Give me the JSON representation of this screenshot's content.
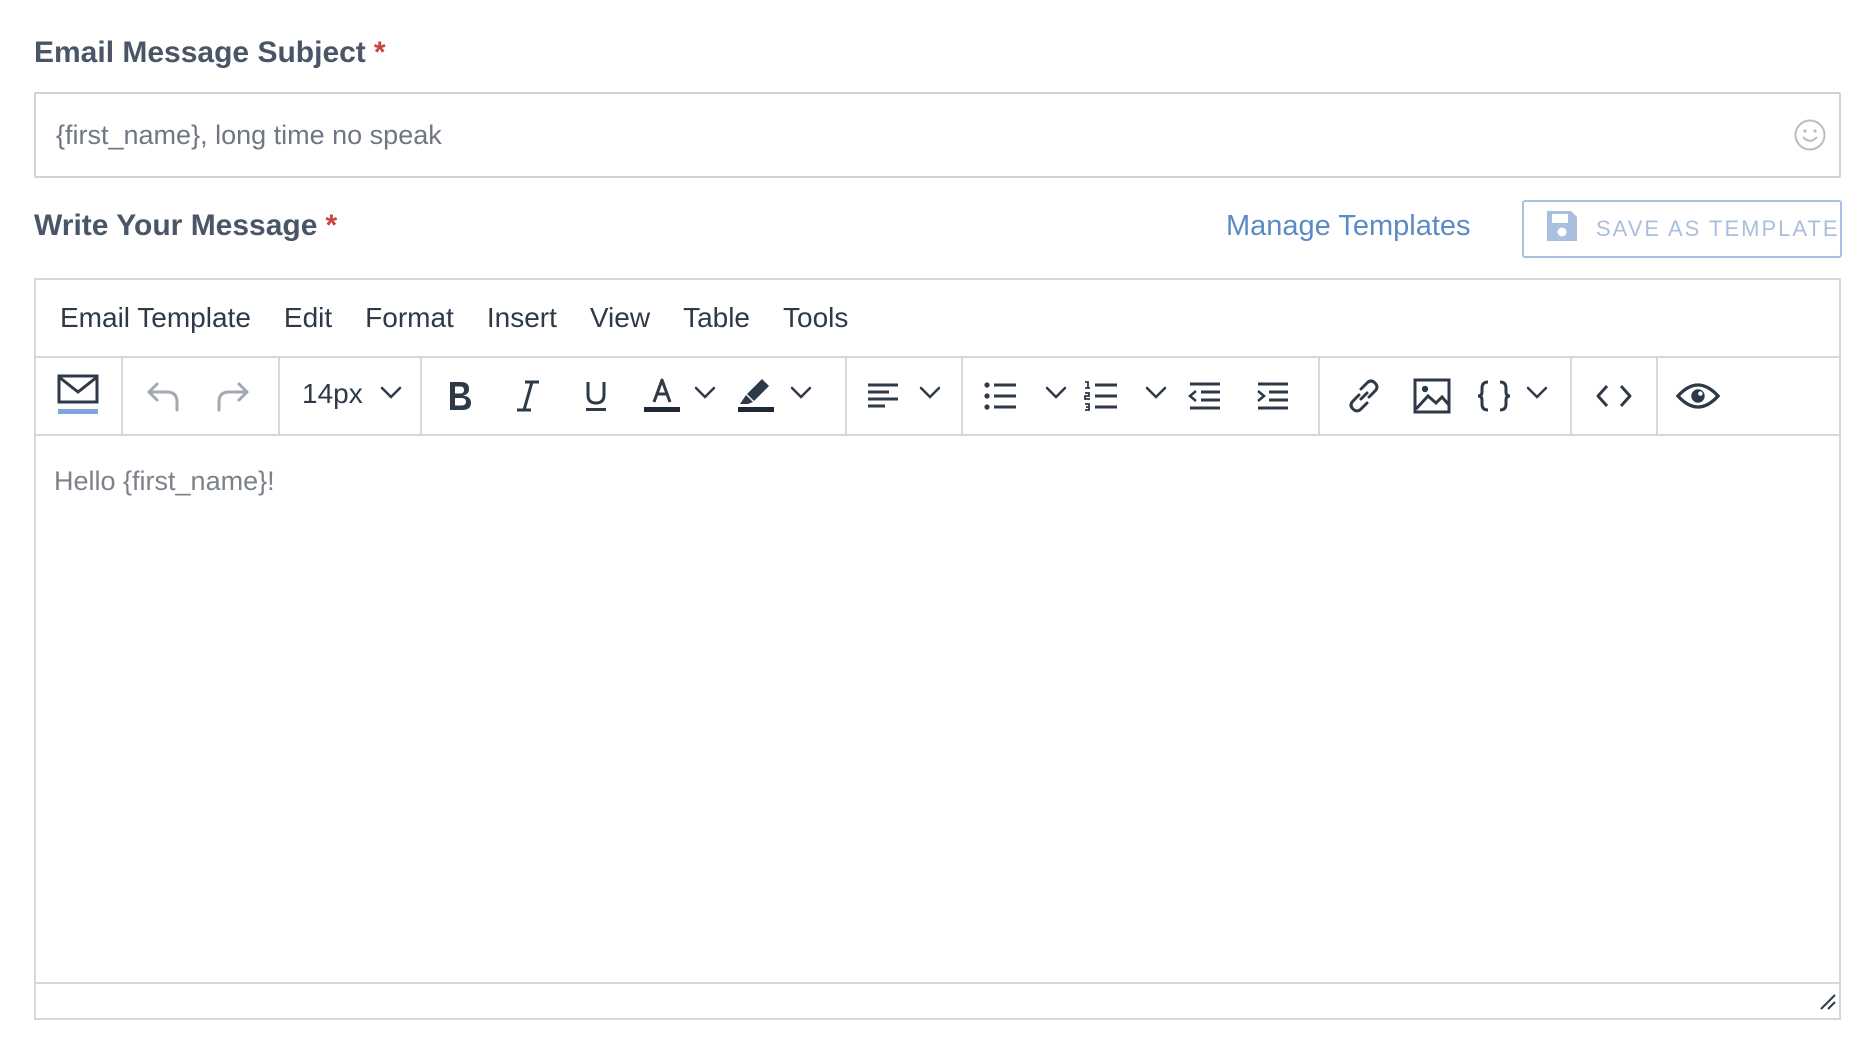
{
  "subject": {
    "label": "Email Message Subject",
    "required_mark": "*",
    "value": "{first_name}, long time no speak"
  },
  "message": {
    "label": "Write Your Message",
    "required_mark": "*",
    "manage_templates": "Manage Templates",
    "save_as_template": "SAVE AS TEMPLATE"
  },
  "editor": {
    "menu": [
      "Email Template",
      "Edit",
      "Format",
      "Insert",
      "View",
      "Table",
      "Tools"
    ],
    "font_size": "14px",
    "content": "Hello {first_name}!"
  },
  "colors": {
    "accent": "#5b8ac6",
    "required": "#c8443e",
    "label": "#4a5668",
    "border": "#d4d7db",
    "email_underline": "#7aa6dc"
  },
  "icons": [
    "email-icon",
    "undo-icon",
    "redo-icon",
    "bold-icon",
    "italic-icon",
    "underline-icon",
    "text-color-icon",
    "highlight-icon",
    "align-left-icon",
    "bullet-list-icon",
    "numbered-list-icon",
    "outdent-icon",
    "indent-icon",
    "link-icon",
    "image-icon",
    "variable-braces-icon",
    "source-code-icon",
    "preview-eye-icon",
    "emoji-icon",
    "floppy-disk-icon",
    "resize-handle-icon"
  ]
}
